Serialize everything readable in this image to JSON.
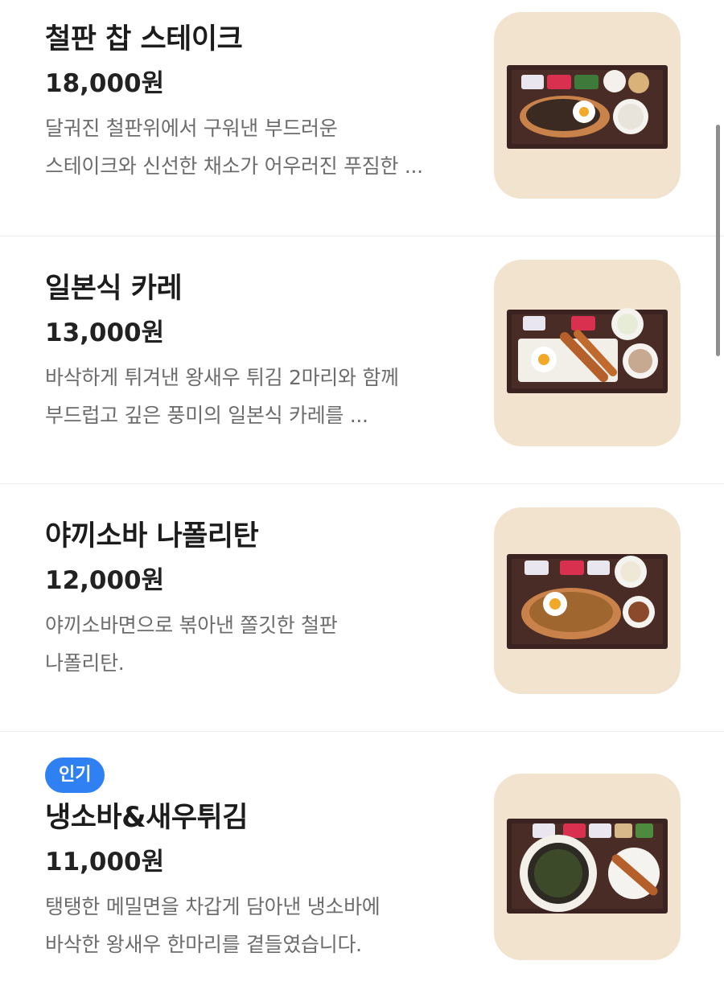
{
  "menu": {
    "items": [
      {
        "name": "철판 찹 스테이크",
        "price": "18,000원",
        "desc_lines": [
          "달궈진 철판위에서 구워낸 부드러운",
          "스테이크와 신선한 채소가 어우러진 푸짐한 ..."
        ],
        "badge": "",
        "image_icon": "steak-set-tray-icon"
      },
      {
        "name": "일본식 카레",
        "price": "13,000원",
        "desc_lines": [
          "바삭하게 튀겨낸 왕새우 튀김 2마리와 함께",
          "부드럽고 깊은 풍미의 일본식 카레를 ..."
        ],
        "badge": "",
        "image_icon": "curry-set-tray-icon"
      },
      {
        "name": "야끼소바 나폴리탄",
        "price": "12,000원",
        "desc_lines": [
          "야끼소바면으로 볶아낸 쫄깃한 철판",
          "나폴리탄."
        ],
        "badge": "",
        "image_icon": "yakisoba-set-tray-icon"
      },
      {
        "name": "냉소바&새우튀김",
        "price": "11,000원",
        "desc_lines": [
          "탱탱한 메밀면을 차갑게 담아낸 냉소바에",
          "바삭한 왕새우 한마리를 곁들였습니다."
        ],
        "badge": "인기",
        "image_icon": "cold-soba-set-tray-icon"
      }
    ]
  },
  "colors": {
    "badge": "#2f80f2",
    "thumb_bg": "#f1e3cd",
    "tray": "#3a2320",
    "divider": "#ececec"
  }
}
